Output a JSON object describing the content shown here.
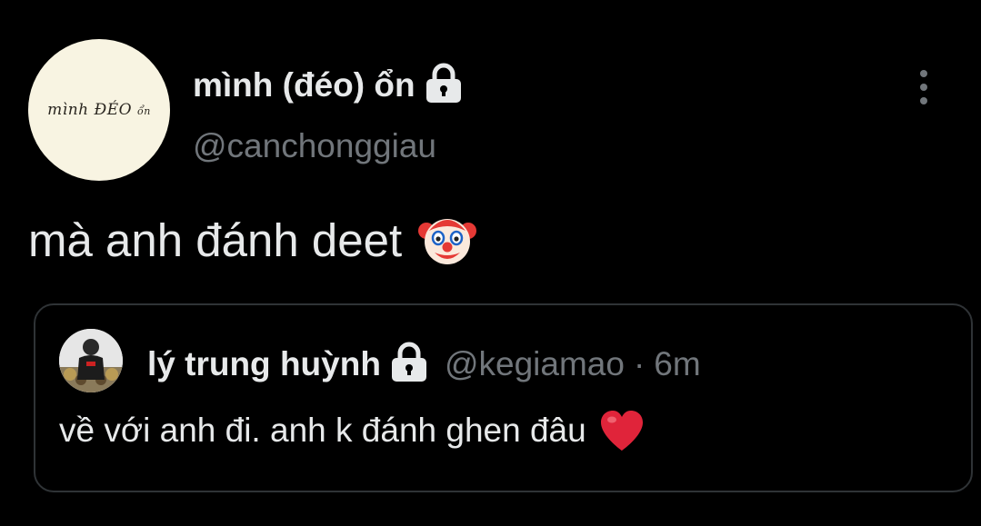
{
  "author": {
    "avatar_text_main": "mình ĐÉO",
    "avatar_text_small": "ổn",
    "display_name": "mình (đéo) ổn",
    "handle": "@canchonggiau",
    "protected_icon": "lock-icon"
  },
  "tweet": {
    "text": "mà anh đánh deet",
    "emoji": "clown-face-icon"
  },
  "quoted_tweet": {
    "display_name": "lý trung huỳnh",
    "handle": "@kegiamao",
    "separator": "·",
    "time": "6m",
    "text": "về với anh đi. anh k đánh ghen đâu",
    "emoji": "red-heart-icon"
  },
  "colors": {
    "background": "#000000",
    "primary_text": "#e7e9ea",
    "secondary_text": "#71767b",
    "border": "#2f3336",
    "avatar_bg": "#f8f4e2",
    "heart": "#e0243a"
  }
}
